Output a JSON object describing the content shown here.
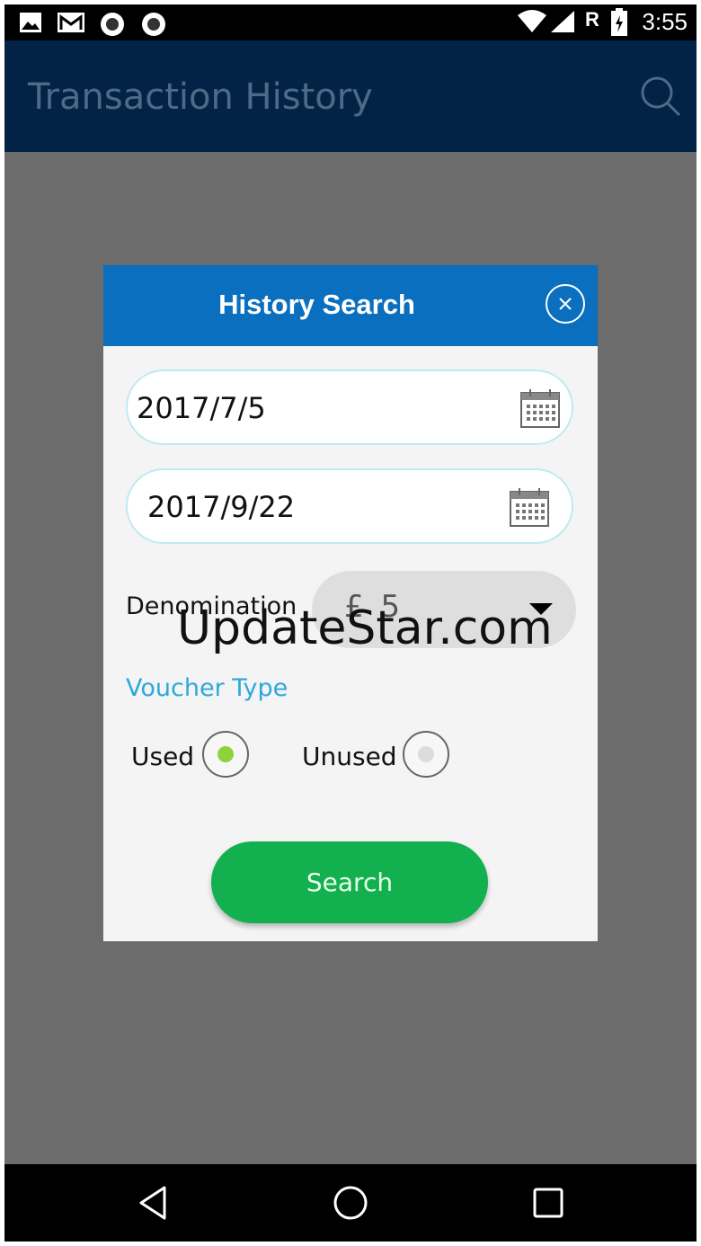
{
  "status_bar": {
    "time": "3:55",
    "network_label": "R",
    "icons": [
      "image-icon",
      "gmail-icon",
      "circle-app-icon",
      "circle-app-icon",
      "wifi-icon",
      "signal-icon",
      "battery-icon"
    ]
  },
  "app_bar": {
    "title": "Transaction History",
    "search_icon": "search-icon"
  },
  "dialog": {
    "title": "History Search",
    "close_icon": "close-icon",
    "start_date": "2017/7/5",
    "end_date": "2017/9/22",
    "denomination_label": "Denomination",
    "denomination_value": "£ 5",
    "voucher_type_label": "Voucher Type",
    "options": [
      {
        "label": "Used",
        "selected": true
      },
      {
        "label": "Unused",
        "selected": false
      }
    ],
    "search_button": "Search"
  },
  "watermark": "UpdateStar.com",
  "colors": {
    "app_bar": "#032346",
    "dialog_header": "#0a6fbe",
    "search_button": "#12b04e",
    "voucher_label": "#2ea8dc",
    "radio_selected": "#8ed33c"
  },
  "nav_bar": {
    "icons": [
      "back-icon",
      "home-icon",
      "recents-icon"
    ]
  }
}
